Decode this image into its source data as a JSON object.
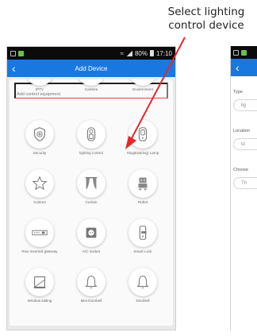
{
  "caption": {
    "line1": "Select lighting",
    "line2": "control device"
  },
  "statusbar": {
    "battery": "80%",
    "time": "17:10"
  },
  "navbar": {
    "title": "Add Device",
    "back_icon": "chevron-left-icon"
  },
  "search": {
    "placeholder": "Add control equipment"
  },
  "partial_row": [
    "IPTV",
    "Camera",
    "Environment"
  ],
  "devices": [
    {
      "label": "Security",
      "icon": "shield-icon"
    },
    {
      "label": "lighting control",
      "icon": "remote-control-icon"
    },
    {
      "label": "Single(wiring) Lamp",
      "icon": "wall-switch-icon"
    },
    {
      "label": "Custom",
      "icon": "star-icon"
    },
    {
      "label": "Curtain",
      "icon": "curtain-icon"
    },
    {
      "label": "Robot",
      "icon": "robot-icon"
    },
    {
      "label": "Row inserted gateway",
      "icon": "power-strip-icon"
    },
    {
      "label": "A/C socket",
      "icon": "socket-icon"
    },
    {
      "label": "Smart Lock",
      "icon": "lock-icon"
    },
    {
      "label": "Window sliding",
      "icon": "window-icon"
    },
    {
      "label": "Mini Doorbell",
      "icon": "doorbell-icon"
    },
    {
      "label": "Doorbell",
      "icon": "bell-icon"
    }
  ],
  "second_screen": {
    "type_label": "Type",
    "type_value": "lig",
    "location_label": "Location",
    "location_value": "to",
    "choose_label": "Choose",
    "choose_value": "Th"
  },
  "colors": {
    "accent": "#1978e0",
    "search_underline": "#e2453e",
    "arrow": "#e8262b"
  }
}
